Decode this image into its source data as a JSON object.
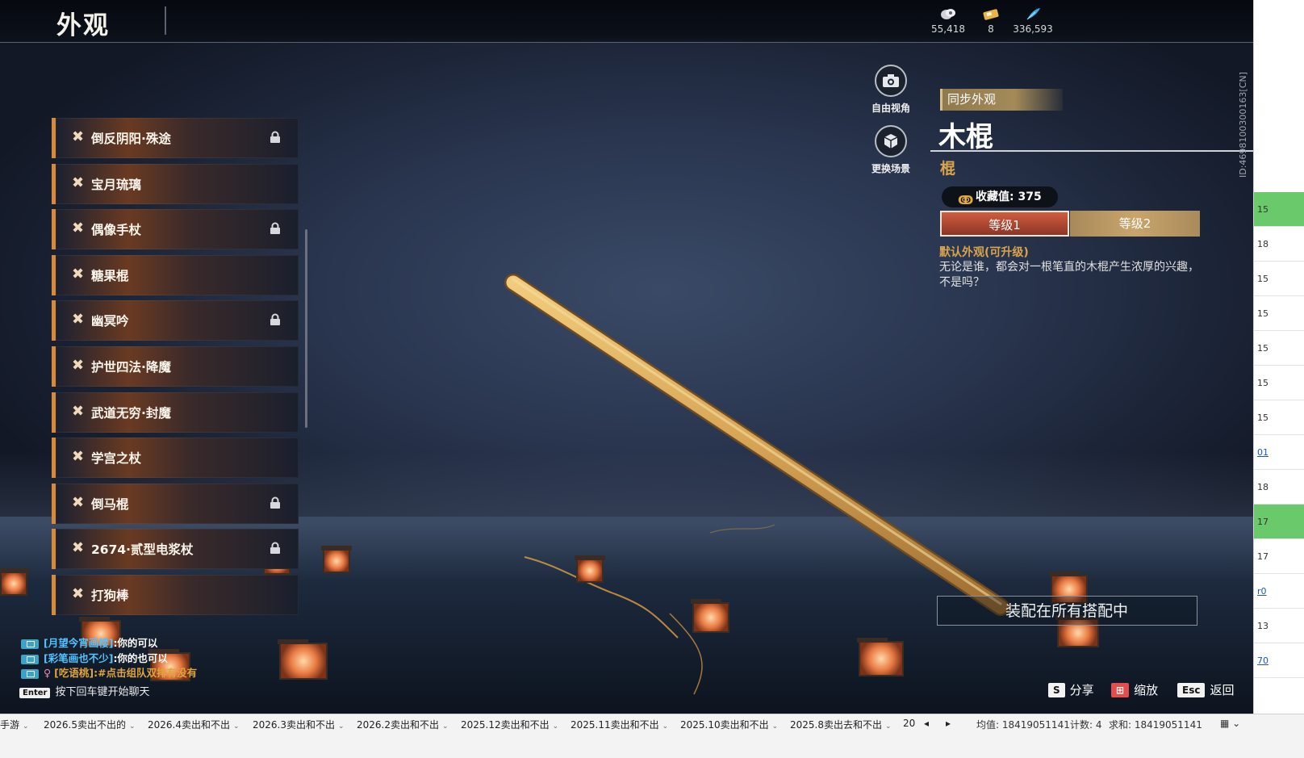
{
  "header": {
    "title": "外观",
    "currencies": [
      {
        "icon": "coin-stack-icon",
        "value": "55,418"
      },
      {
        "icon": "ticket-icon",
        "value": "8"
      },
      {
        "icon": "feather-icon",
        "value": "336,593"
      }
    ]
  },
  "skin_list": [
    {
      "name": "倒反阴阳·殊途",
      "locked": true
    },
    {
      "name": "宝月琉璃",
      "locked": false
    },
    {
      "name": "偶像手杖",
      "locked": true
    },
    {
      "name": "糖果棍",
      "locked": false
    },
    {
      "name": "幽冥吟",
      "locked": true
    },
    {
      "name": "护世四法·降魔",
      "locked": false
    },
    {
      "name": "武道无穷·封魔",
      "locked": false
    },
    {
      "name": "学宫之杖",
      "locked": false
    },
    {
      "name": "倒马棍",
      "locked": true
    },
    {
      "name": "2674·贰型电浆杖",
      "locked": true
    },
    {
      "name": "打狗棒",
      "locked": false
    }
  ],
  "view_buttons": {
    "free_view": "自由视角",
    "change_scene": "更换场景"
  },
  "detail": {
    "sync_label": "同步外观",
    "item_name": "木棍",
    "item_type": "棍",
    "collect_label": "收藏值:",
    "collect_value": "375",
    "level1": "等级1",
    "level2": "等级2",
    "desc_title": "默认外观(可升级)",
    "desc_text": "无论是谁，都会对一根笔直的木棍产生浓厚的兴趣，不是吗？",
    "equip_label": "装配在所有搭配中",
    "user_id": "ID:4698100300163[CN]"
  },
  "chat": {
    "lines": [
      {
        "name": "[月望今宵画楼]",
        "message": ":你的可以",
        "gold": false
      },
      {
        "name": "[彩笔画也不少]",
        "message": ":你的也可以",
        "gold": false
      },
      {
        "name": "[吃语桃]",
        "message": ":#点击组队双排有没有",
        "gold": true
      }
    ],
    "enter_key": "Enter",
    "enter_hint": "按下回车键开始聊天"
  },
  "hotkeys": [
    {
      "key": "S",
      "label": "分享"
    },
    {
      "key": "⊞",
      "label": "缩放"
    },
    {
      "key": "Esc",
      "label": "返回"
    }
  ],
  "excel": {
    "right_cells": [
      "15",
      "18",
      "15",
      "15",
      "15",
      "15",
      "15",
      "01",
      "18",
      "17",
      "17",
      "r0",
      "13",
      "70"
    ],
    "sheet_tabs": [
      "手游",
      "2026.5卖出不出的",
      "2026.4卖出和不出",
      "2026.3卖出和不出",
      "2026.2卖出和不出",
      "2025.12卖出和不出",
      "2025.11卖出和不出",
      "2025.10卖出和不出",
      "2025.8卖出去和不出",
      "20"
    ],
    "status": {
      "avg": "均值: 18419051141",
      "count": "计数: 4",
      "sum": "求和: 18419051141"
    }
  },
  "colors": {
    "accent_orange": "#d88a3a",
    "gold_text": "#d9a44c",
    "level1_red": "#d05d3f",
    "chat_blue": "#51c4ff"
  }
}
